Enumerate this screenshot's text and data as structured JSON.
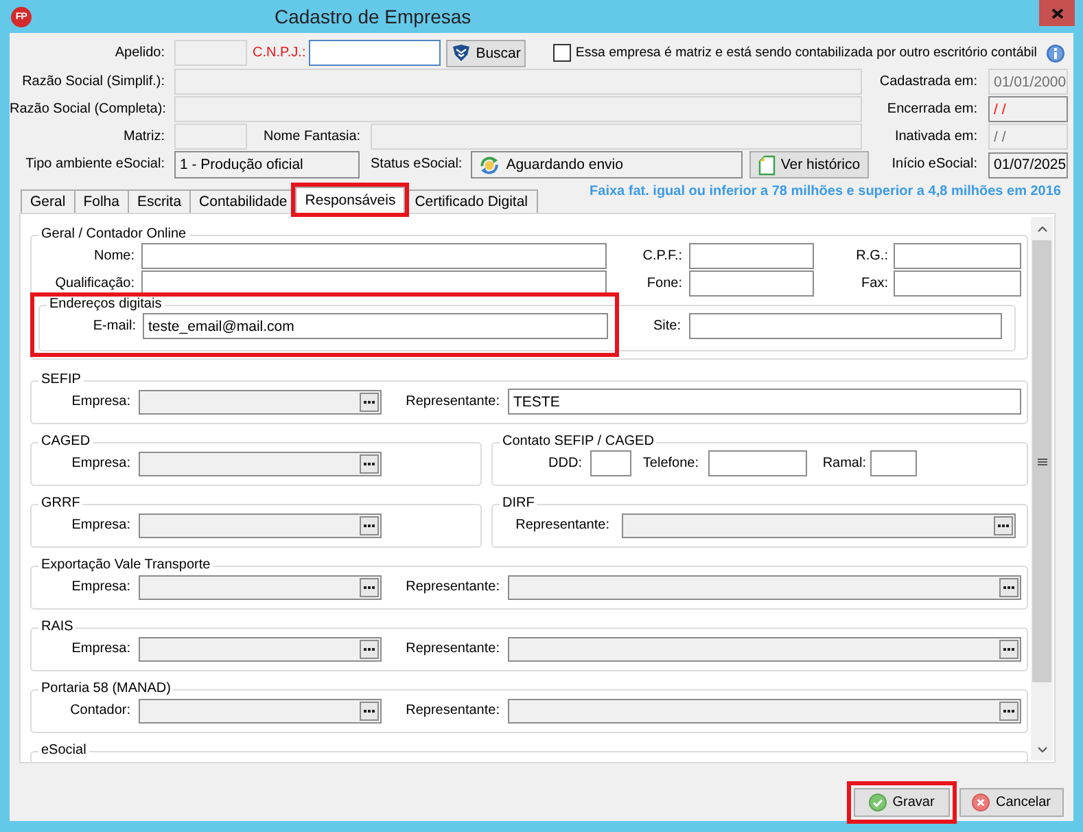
{
  "window": {
    "title": "Cadastro de Empresas",
    "logo": "FP"
  },
  "header": {
    "apelido": {
      "label": "Apelido:",
      "disabled": true
    },
    "cnpj": {
      "label": "C.N.P.J.:",
      "required": true,
      "disabled": false,
      "read_only": false,
      "focused": true
    },
    "search_button": {
      "label": "Buscar"
    },
    "matriz_checkbox": {
      "label": "Essa empresa é matriz e está sendo contabilizada por outro escritório contábil",
      "checked": false
    },
    "razao_social_simplif": {
      "label": "Razão Social (Simplif.):",
      "disabled": true
    },
    "razao_social_completa": {
      "label": "Razão Social (Completa):",
      "disabled": true
    },
    "matriz": {
      "label": "Matriz:",
      "disabled": true
    },
    "nome_fantasia": {
      "label": "Nome Fantasia:",
      "disabled": true
    },
    "tipo_ambiente_esocial": {
      "label": "Tipo ambiente eSocial:",
      "value": "1 - Produção oficial",
      "disabled": false,
      "read_only": true
    },
    "status_esocial": {
      "label": "Status eSocial:",
      "value": "Aguardando envio"
    },
    "history_button": {
      "label": "Ver histórico"
    },
    "dates": [
      {
        "label": "Cadastrada em:",
        "value": "01/01/2000",
        "disabled": true
      },
      {
        "label": "Encerrada em:",
        "value": "/ /",
        "disabled": false,
        "read_only": true,
        "color": "#ff0000"
      },
      {
        "label": "Inativada em:",
        "value": "/ /",
        "disabled": true
      },
      {
        "label": "Início eSocial:",
        "value": "01/07/2025",
        "disabled": false,
        "read_only": true
      }
    ]
  },
  "tabs": {
    "items": [
      {
        "label": "Geral",
        "selected": false,
        "highlighted": false
      },
      {
        "label": "Folha",
        "selected": false,
        "highlighted": false
      },
      {
        "label": "Escrita",
        "selected": false,
        "highlighted": false
      },
      {
        "label": "Contabilidade",
        "selected": false,
        "highlighted": false
      },
      {
        "label": "Responsáveis",
        "selected": true,
        "highlighted": true
      },
      {
        "label": "Certificado Digital",
        "selected": false,
        "highlighted": false
      }
    ],
    "note": "Faixa fat. igual ou inferior a 78 milhões e superior a 4,8 milhões em 2016"
  },
  "panel": {
    "contador": {
      "title": "Geral / Contador Online",
      "rows": [
        [
          {
            "label": "Nome:",
            "read_only": false
          },
          {
            "label": "C.P.F.:",
            "read_only": false
          },
          {
            "label": "R.G.:",
            "read_only": false
          }
        ],
        [
          {
            "label": "Qualificação:",
            "read_only": false
          },
          {
            "label": "Fone:",
            "read_only": false
          },
          {
            "label": "Fax:",
            "read_only": false
          }
        ]
      ],
      "digital": {
        "title": "Endereços digitais",
        "highlighted": true,
        "fields": [
          {
            "label": "E-mail:",
            "value": "teste_email@mail.com",
            "read_only": false
          },
          {
            "label": "Site:",
            "read_only": false
          }
        ]
      }
    },
    "group_rows": [
      [
        {
          "title": "SEFIP",
          "kind": "pair",
          "fields": [
            {
              "label": "Empresa:",
              "kind": "lookup",
              "read_only": true
            },
            {
              "label": "Representante:",
              "kind": "text",
              "value": "TESTE",
              "read_only": false
            }
          ]
        }
      ],
      [
        {
          "title": "CAGED",
          "kind": "single",
          "fields": [
            {
              "label": "Empresa:",
              "kind": "lookup",
              "read_only": true
            }
          ]
        },
        {
          "title": "Contato SEFIP / CAGED",
          "kind": "contact",
          "fields": [
            {
              "label": "DDD:",
              "kind": "text",
              "read_only": false
            },
            {
              "label": "Telefone:",
              "kind": "text",
              "read_only": false
            },
            {
              "label": "Ramal:",
              "kind": "text",
              "read_only": false
            }
          ]
        }
      ],
      [
        {
          "title": "GRRF",
          "kind": "single",
          "fields": [
            {
              "label": "Empresa:",
              "kind": "lookup",
              "read_only": true
            }
          ]
        },
        {
          "title": "DIRF",
          "kind": "single",
          "fields": [
            {
              "label": "Representante:",
              "kind": "lookup",
              "read_only": true
            }
          ]
        }
      ],
      [
        {
          "title": "Exportação Vale Transporte",
          "kind": "pair",
          "fields": [
            {
              "label": "Empresa:",
              "kind": "lookup",
              "read_only": true
            },
            {
              "label": "Representante:",
              "kind": "lookup",
              "read_only": true
            }
          ]
        }
      ],
      [
        {
          "title": "RAIS",
          "kind": "pair",
          "fields": [
            {
              "label": "Empresa:",
              "kind": "lookup",
              "read_only": true
            },
            {
              "label": "Representante:",
              "kind": "lookup",
              "read_only": true
            }
          ]
        }
      ],
      [
        {
          "title": "Portaria 58 (MANAD)",
          "kind": "pair",
          "fields": [
            {
              "label": "Contador:",
              "kind": "lookup",
              "read_only": true
            },
            {
              "label": "Representante:",
              "kind": "lookup",
              "read_only": true
            }
          ]
        }
      ],
      [
        {
          "title": "eSocial"
        }
      ]
    ]
  },
  "buttons": [
    {
      "label": "Gravar",
      "kind": "confirm",
      "highlighted": true
    },
    {
      "label": "Cancelar",
      "kind": "cancel",
      "highlighted": false
    }
  ]
}
